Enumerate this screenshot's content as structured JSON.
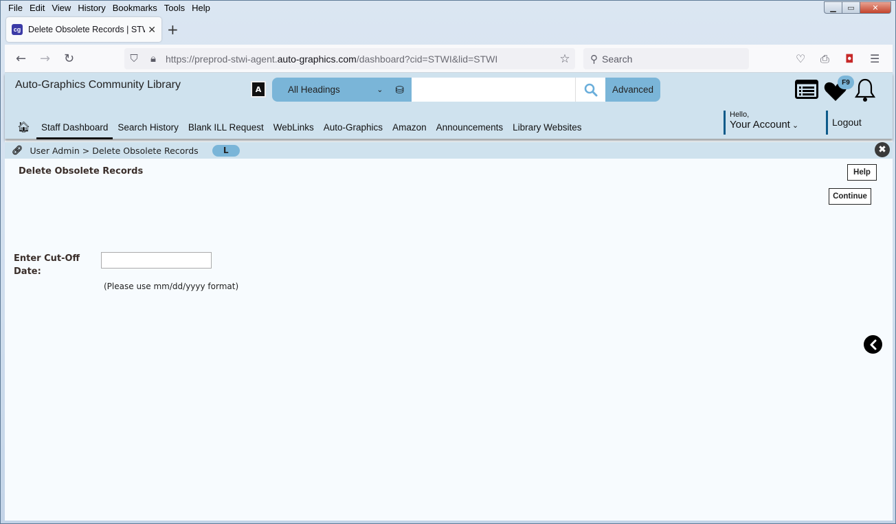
{
  "browser": {
    "menu": [
      "File",
      "Edit",
      "View",
      "History",
      "Bookmarks",
      "Tools",
      "Help"
    ],
    "tab": {
      "title": "Delete Obsolete Records | STWI",
      "icon": "cg"
    },
    "url": {
      "prefix": "https://preprod-stwi-agent.",
      "domain": "auto-graphics.com",
      "path": "/dashboard?cid=STWI&lid=STWI"
    },
    "search_placeholder": "Search"
  },
  "header": {
    "library_name": "Auto-Graphics Community Library",
    "search": {
      "scope": "All Headings",
      "query": "",
      "advanced_label": "Advanced"
    },
    "f9_badge": "F9"
  },
  "nav": {
    "items": [
      "Staff Dashboard",
      "Search History",
      "Blank ILL Request",
      "WebLinks",
      "Auto-Graphics",
      "Amazon",
      "Announcements",
      "Library Websites"
    ],
    "active": "Staff Dashboard",
    "account": {
      "greeting": "Hello,",
      "label": "Your Account"
    },
    "logout": "Logout"
  },
  "breadcrumb": {
    "text": "User Admin > Delete Obsolete Records",
    "badge": "L"
  },
  "page": {
    "title": "Delete Obsolete Records",
    "help_label": "Help",
    "continue_label": "Continue",
    "cutoff_label": "Enter Cut-Off Date:",
    "cutoff_value": "",
    "hint": "(Please use mm/dd/yyyy format)"
  }
}
